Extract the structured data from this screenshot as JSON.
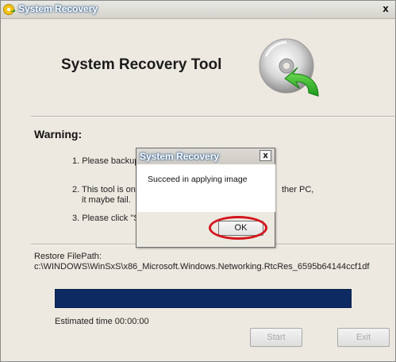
{
  "window": {
    "title": "System Recovery",
    "close_glyph": "x",
    "icon": "recovery-app-icon"
  },
  "header": {
    "heading": "System Recovery Tool",
    "graphic": "disc-restore-icon"
  },
  "warning": {
    "label": "Warning:",
    "line1": "1. Please backup",
    "line2a": "2. This tool is onl",
    "line2a_right": "ther PC,",
    "line2b": "it maybe fail.",
    "line3": "3. Please click \"S"
  },
  "restore": {
    "label": "Restore FilePath:",
    "path": "c:\\WINDOWS\\WinSxS\\x86_Microsoft.Windows.Networking.RtcRes_6595b64144ccf1df"
  },
  "progress": {
    "fraction": 1.0,
    "fill_color": "#0d2a63"
  },
  "status": {
    "estimated": "Estimated time 00:00:00"
  },
  "buttons": {
    "start": "Start",
    "exit": "Exit"
  },
  "dialog": {
    "title": "System Recovery",
    "close_glyph": "x",
    "message": "Succeed in applying image",
    "ok": "OK",
    "highlight_color": "#d4161d"
  }
}
